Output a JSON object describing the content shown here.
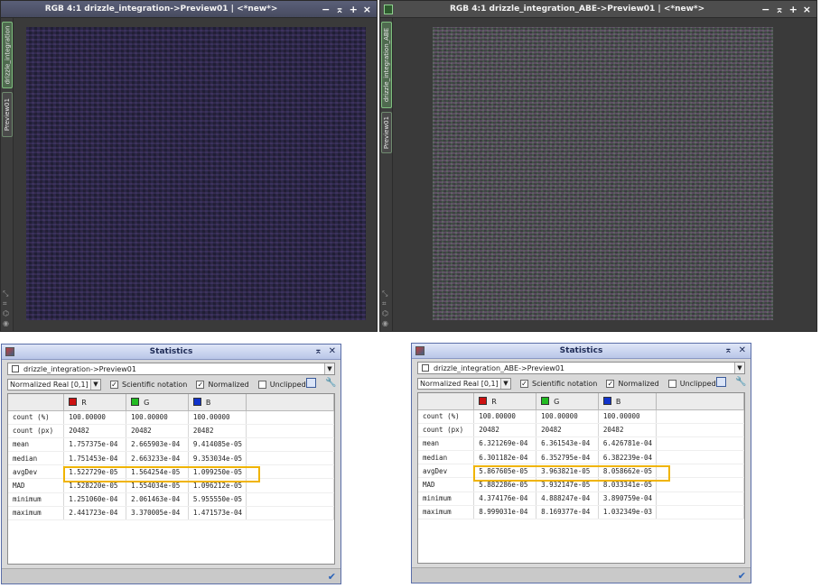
{
  "colors": {
    "red": "#cc1111",
    "green": "#22bb22",
    "blue": "#1133cc",
    "highlight": "#f0b400"
  },
  "windows": [
    {
      "title": "RGB 4:1 drizzle_integration->Preview01 | <*new*>",
      "tabs": [
        "drizzle_integration",
        "Preview01"
      ],
      "buttons": [
        "−",
        "⌅",
        "+",
        "×"
      ]
    },
    {
      "title": "RGB 4:1 drizzle_integration_ABE->Preview01 | <*new*>",
      "tabs": [
        "drizzle_integration_ABE",
        "Preview01"
      ],
      "buttons": [
        "−",
        "⌅",
        "+",
        "×"
      ]
    }
  ],
  "statistics": [
    {
      "title": "Statistics",
      "view": "drizzle_integration->Preview01",
      "range": "Normalized Real [0,1]",
      "options": {
        "scientific": "Scientific notation",
        "normalized": "Normalized",
        "unclipped": "Unclipped"
      },
      "channels": [
        "R",
        "G",
        "B"
      ],
      "rows": [
        {
          "label": "count (%)",
          "values": [
            "100.00000",
            "100.00000",
            "100.00000"
          ]
        },
        {
          "label": "count (px)",
          "values": [
            "20482",
            "20482",
            "20482"
          ]
        },
        {
          "label": "mean",
          "values": [
            "1.757375e-04",
            "2.665903e-04",
            "9.414085e-05"
          ]
        },
        {
          "label": "median",
          "values": [
            "1.751453e-04",
            "2.663233e-04",
            "9.353034e-05"
          ]
        },
        {
          "label": "avgDev",
          "values": [
            "1.522729e-05",
            "1.564254e-05",
            "1.099250e-05"
          ]
        },
        {
          "label": "MAD",
          "values": [
            "1.528220e-05",
            "1.554034e-05",
            "1.096212e-05"
          ]
        },
        {
          "label": "minimum",
          "values": [
            "1.251060e-04",
            "2.061463e-04",
            "5.955550e-05"
          ]
        },
        {
          "label": "maximum",
          "values": [
            "2.441723e-04",
            "3.370005e-04",
            "1.471573e-04"
          ]
        }
      ]
    },
    {
      "title": "Statistics",
      "view": "drizzle_integration_ABE->Preview01",
      "range": "Normalized Real [0,1]",
      "options": {
        "scientific": "Scientific notation",
        "normalized": "Normalized",
        "unclipped": "Unclipped"
      },
      "channels": [
        "R",
        "G",
        "B"
      ],
      "rows": [
        {
          "label": "count (%)",
          "values": [
            "100.00000",
            "100.00000",
            "100.00000"
          ]
        },
        {
          "label": "count (px)",
          "values": [
            "20482",
            "20482",
            "20482"
          ]
        },
        {
          "label": "mean",
          "values": [
            "6.321269e-04",
            "6.361543e-04",
            "6.426781e-04"
          ]
        },
        {
          "label": "median",
          "values": [
            "6.301182e-04",
            "6.352795e-04",
            "6.382239e-04"
          ]
        },
        {
          "label": "avgDev",
          "values": [
            "5.867605e-05",
            "3.963821e-05",
            "8.058662e-05"
          ]
        },
        {
          "label": "MAD",
          "values": [
            "5.882286e-05",
            "3.932147e-05",
            "8.033341e-05"
          ]
        },
        {
          "label": "minimum",
          "values": [
            "4.374176e-04",
            "4.888247e-04",
            "3.890759e-04"
          ]
        },
        {
          "label": "maximum",
          "values": [
            "8.999031e-04",
            "8.169377e-04",
            "1.032349e-03"
          ]
        }
      ]
    }
  ]
}
